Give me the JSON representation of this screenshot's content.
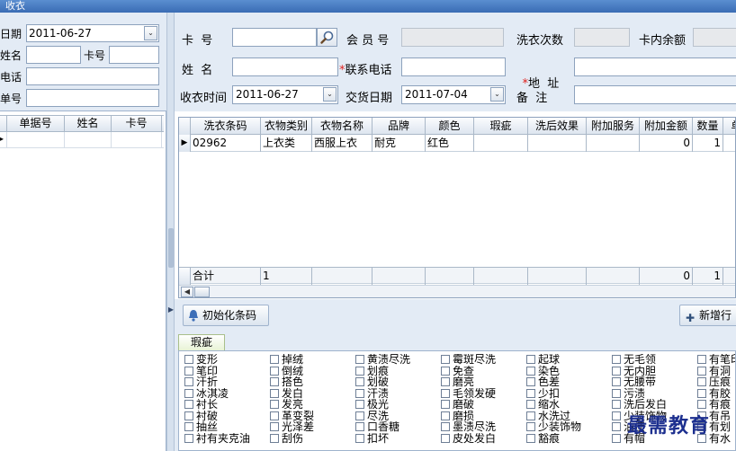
{
  "window": {
    "title": "收衣"
  },
  "left": {
    "date_label": "日期",
    "date_value": "2011-06-27",
    "name_label": "姓名",
    "card_label": "卡号",
    "phone_label": "电话",
    "order_label": "单号",
    "table_headers": [
      "单据号",
      "姓名",
      "卡号"
    ]
  },
  "form": {
    "card_no_label": "卡  号",
    "member_no_label": "会 员 号",
    "wash_count_label": "洗衣次数",
    "balance_label": "卡内余额",
    "name_label": "姓  名",
    "required_mark": "*",
    "contact_phone_label": "联系电话",
    "address_label": "地  址",
    "receive_time_label": "收衣时间",
    "receive_time_value": "2011-06-27",
    "delivery_date_label": "交货日期",
    "delivery_date_value": "2011-07-04",
    "remark_label": "备  注"
  },
  "grid": {
    "headers": [
      "洗衣条码",
      "衣物类别",
      "衣物名称",
      "品牌",
      "颜色",
      "瑕疵",
      "洗后效果",
      "附加服务",
      "附加金额",
      "数量",
      "单"
    ],
    "rows": [
      {
        "barcode": "02962",
        "category": "上衣类",
        "name": "西服上衣",
        "brand": "耐克",
        "color": "红色",
        "defect": "",
        "effect": "",
        "service": "",
        "amount": "0",
        "qty": "1",
        "extra": ""
      }
    ],
    "total": {
      "label": "合计",
      "col2": "1",
      "amount": "0",
      "qty": "1"
    }
  },
  "toolbar": {
    "init_barcode_label": "初始化条码",
    "add_row_label": "新增行"
  },
  "defects": {
    "tab_label": "瑕疵",
    "items": [
      "变形",
      "掉绒",
      "黄渍尽洗",
      "霉斑尽洗",
      "起球",
      "无毛领",
      "有笔印",
      "笔印",
      "倒绒",
      "划痕",
      "免查",
      "染色",
      "无内胆",
      "有洞",
      "汗折",
      "搭色",
      "划破",
      "磨亮",
      "色差",
      "无腰带",
      "压痕",
      "冰淇凌",
      "发白",
      "汗渍",
      "毛领发硬",
      "少扣",
      "污渍",
      "有胶",
      "衬长",
      "发亮",
      "极光",
      "磨破",
      "缩水",
      "洗后发白",
      "有痕",
      "衬破",
      "革变裂",
      "尽洗",
      "磨损",
      "水洗过",
      "少装饰物",
      "有吊",
      "抽丝",
      "光泽差",
      "口香糖",
      "墨渍尽洗",
      "少装饰物",
      "油渍",
      "有划",
      "衬有夹克油",
      "刮伤",
      "扣坏",
      "皮处发白",
      "豁痕",
      "有帽",
      "有水"
    ]
  },
  "watermark": "最需教育"
}
